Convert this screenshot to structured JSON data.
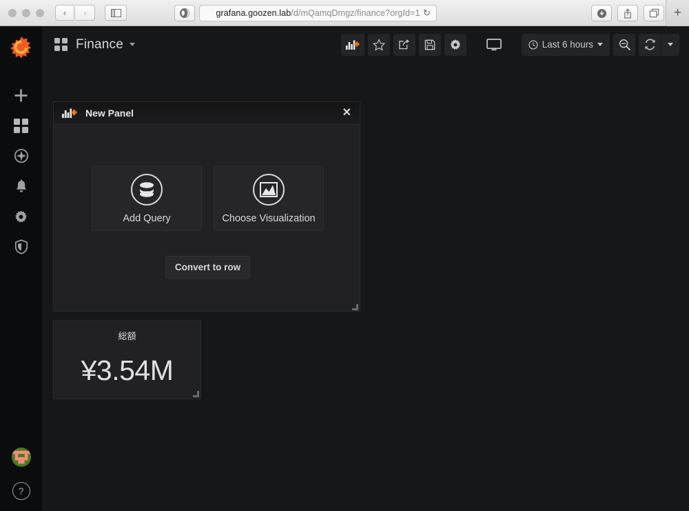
{
  "browser": {
    "back_label": "‹",
    "forward_label": "›",
    "sidebar_label": "sidebar-toggle",
    "url_host": "grafana.goozen.lab",
    "url_path": "/d/mQamqDmgz/finance?orgId=1",
    "reload_label": "↻",
    "new_tab_label": "+"
  },
  "sidebar": {
    "logo": "grafana-logo",
    "items": [
      {
        "name": "create",
        "icon": "plus-icon"
      },
      {
        "name": "dashboards",
        "icon": "dashboards-icon"
      },
      {
        "name": "explore",
        "icon": "compass-icon"
      },
      {
        "name": "alerting",
        "icon": "bell-icon"
      },
      {
        "name": "configuration",
        "icon": "gear-icon"
      },
      {
        "name": "server-admin",
        "icon": "shield-icon"
      }
    ],
    "help_label": "?"
  },
  "navbar": {
    "dashboard_title": "Finance",
    "buttons": [
      {
        "name": "add-panel",
        "icon": "add-panel-icon"
      },
      {
        "name": "mark-favorite",
        "icon": "star-icon"
      },
      {
        "name": "share-dashboard",
        "icon": "share-icon"
      },
      {
        "name": "save-dashboard",
        "icon": "save-icon"
      },
      {
        "name": "dashboard-settings",
        "icon": "gear-icon"
      },
      {
        "name": "cycle-view-mode",
        "icon": "monitor-icon"
      }
    ],
    "time_range": "Last 6 hours",
    "zoom_out_label": "zoom-out-icon",
    "refresh_label": "refresh-icon"
  },
  "new_panel": {
    "title": "New Panel",
    "close_label": "✕",
    "add_query_label": "Add Query",
    "choose_visualization_label": "Choose Visualization",
    "convert_to_row_label": "Convert to row"
  },
  "stat_panel": {
    "title": "総額",
    "value": "¥3.54M"
  },
  "colors": {
    "accent_orange": "#eb7b18",
    "panel_bg": "#212124",
    "app_bg": "#161719",
    "sidebar_bg": "#0b0c0e",
    "text": "#d8d9da"
  }
}
